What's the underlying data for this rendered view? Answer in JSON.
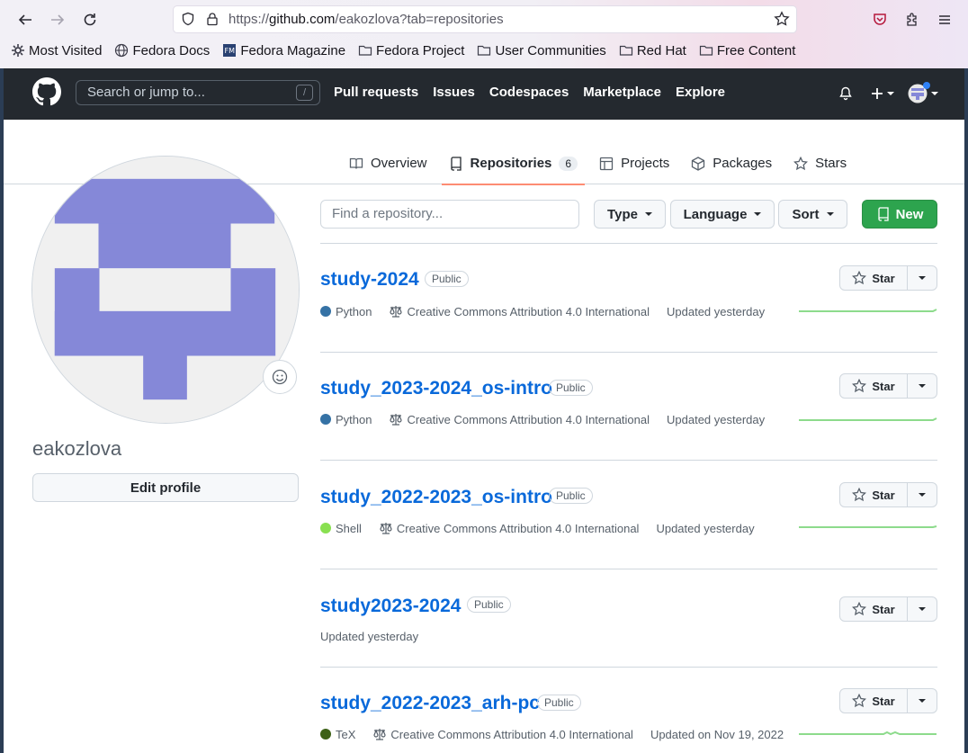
{
  "browser": {
    "url_prefix": "https://",
    "url_host": "github.com",
    "url_path": "/eakozlova?tab=repositories",
    "bookmarks": [
      {
        "label": "Most Visited",
        "icon": "gear-icon"
      },
      {
        "label": "Fedora Docs",
        "icon": "globe-icon"
      },
      {
        "label": "Fedora Magazine",
        "icon": "fedora-magazine-icon"
      },
      {
        "label": "Fedora Project",
        "icon": "folder-icon"
      },
      {
        "label": "User Communities",
        "icon": "folder-icon"
      },
      {
        "label": "Red Hat",
        "icon": "folder-icon"
      },
      {
        "label": "Free Content",
        "icon": "folder-icon"
      }
    ]
  },
  "github": {
    "search_placeholder": "Search or jump to...",
    "search_shortcut": "/",
    "nav": [
      "Pull requests",
      "Issues",
      "Codespaces",
      "Marketplace",
      "Explore"
    ]
  },
  "profile_tabs": [
    {
      "label": "Overview",
      "icon": "book-icon"
    },
    {
      "label": "Repositories",
      "icon": "repo-icon",
      "count": "6",
      "selected": true
    },
    {
      "label": "Projects",
      "icon": "table-icon"
    },
    {
      "label": "Packages",
      "icon": "package-icon"
    },
    {
      "label": "Stars",
      "icon": "star-icon"
    }
  ],
  "profile": {
    "username": "eakozlova",
    "edit_label": "Edit profile",
    "avatar_color": "#8588d8"
  },
  "filters": {
    "find_placeholder": "Find a repository...",
    "type_label": "Type",
    "language_label": "Language",
    "sort_label": "Sort",
    "new_label": "New"
  },
  "star_label": "Star",
  "repositories": [
    {
      "name": "study-2024",
      "visibility": "Public",
      "language": "Python",
      "language_color": "#3572A5",
      "license": "Creative Commons Attribution 4.0 International",
      "updated": "Updated yesterday"
    },
    {
      "name": "study_2023-2024_os-intro",
      "visibility": "Public",
      "language": "Python",
      "language_color": "#3572A5",
      "license": "Creative Commons Attribution 4.0 International",
      "updated": "Updated yesterday"
    },
    {
      "name": "study_2022-2023_os-intro",
      "visibility": "Public",
      "language": "Shell",
      "language_color": "#89e051",
      "license": "Creative Commons Attribution 4.0 International",
      "updated": "Updated yesterday"
    },
    {
      "name": "study2023-2024",
      "visibility": "Public",
      "language": "",
      "language_color": "",
      "license": "",
      "updated": "Updated yesterday"
    },
    {
      "name": "study_2022-2023_arh-pc",
      "visibility": "Public",
      "language": "TeX",
      "language_color": "#3D6117",
      "license": "Creative Commons Attribution 4.0 International",
      "updated": "Updated on Nov 19, 2022"
    }
  ]
}
